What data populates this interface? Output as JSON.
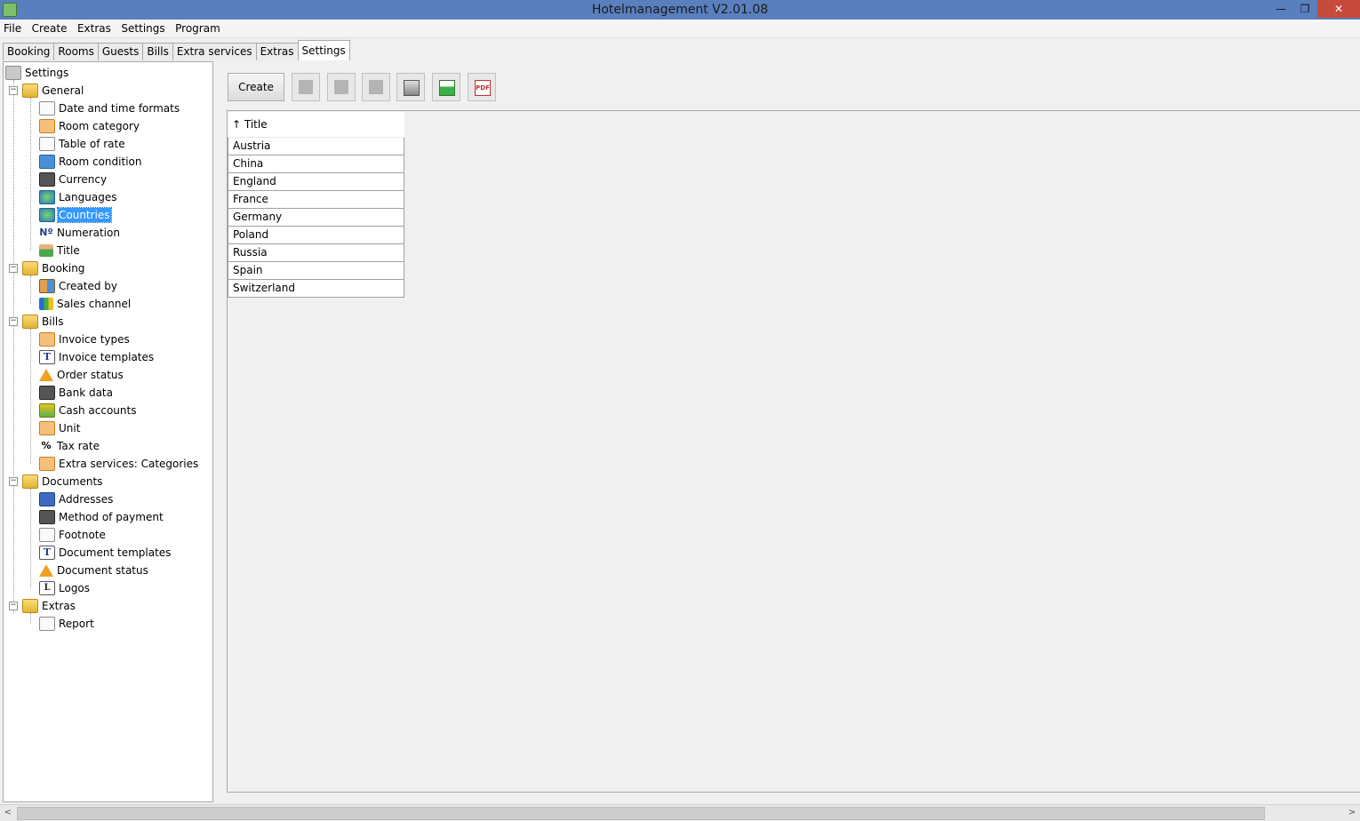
{
  "window": {
    "title": "Hotelmanagement V2.01.08",
    "min_glyph": "—",
    "max_glyph": "❐",
    "close_glyph": "✕"
  },
  "menu": [
    "File",
    "Create",
    "Extras",
    "Settings",
    "Program"
  ],
  "tabs": [
    "Booking",
    "Rooms",
    "Guests",
    "Bills",
    "Extra services",
    "Extras",
    "Settings"
  ],
  "active_tab": "Settings",
  "tree": {
    "root": "Settings",
    "groups": [
      {
        "label": "General",
        "items": [
          "Date and time formats",
          "Room category",
          "Table of rate",
          "Room condition",
          "Currency",
          "Languages",
          "Countries",
          "Numeration",
          "Title"
        ]
      },
      {
        "label": "Booking",
        "items": [
          "Created by",
          "Sales channel"
        ]
      },
      {
        "label": "Bills",
        "items": [
          "Invoice types",
          "Invoice templates",
          "Order status",
          "Bank data",
          "Cash accounts",
          "Unit",
          "Tax rate",
          "Extra services: Categories"
        ]
      },
      {
        "label": "Documents",
        "items": [
          "Addresses",
          "Method of payment",
          "Footnote",
          "Document templates",
          "Document status",
          "Logos"
        ]
      },
      {
        "label": "Extras",
        "items": [
          "Report"
        ]
      }
    ],
    "selected": "Countries",
    "numeration_glyph": "Nº",
    "tax_glyph": "%",
    "template_glyph": "T",
    "logos_glyph": "L"
  },
  "toolbar": {
    "create_label": "Create",
    "pdf_glyph": "PDF"
  },
  "grid": {
    "header": "↑ Title",
    "rows": [
      "Austria",
      "China",
      "England",
      "France",
      "Germany",
      "Poland",
      "Russia",
      "Spain",
      "Switzerland"
    ]
  },
  "scrollbar": {
    "left_arrow": "<",
    "right_arrow": ">"
  }
}
